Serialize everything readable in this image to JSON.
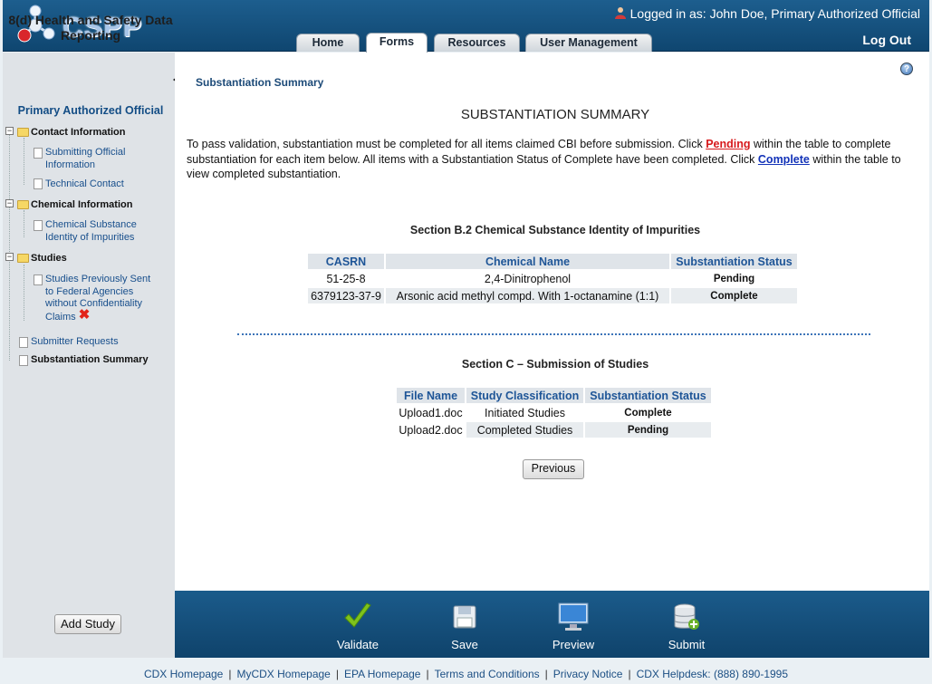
{
  "header": {
    "logo_text": "CSPP",
    "logged_in_prefix": "Logged in as:",
    "logged_in_user": "John Doe, Primary Authorized Official",
    "logout_label": "Log Out",
    "tabs": [
      {
        "label": "Home",
        "active": false
      },
      {
        "label": "Forms",
        "active": true
      },
      {
        "label": "Resources",
        "active": false
      },
      {
        "label": "User Management",
        "active": false
      }
    ]
  },
  "sidebar": {
    "title": "8(d) Health and Safety Data Reporting",
    "role": "Primary Authorized Official",
    "tree": {
      "contact": {
        "label": "Contact Information",
        "children": [
          "Submitting Official Information",
          "Technical Contact"
        ]
      },
      "chemical": {
        "label": "Chemical Information",
        "children": [
          "Chemical Substance Identity of Impurities"
        ]
      },
      "studies": {
        "label": "Studies",
        "children": [
          "Studies Previously Sent to Federal Agencies without Confidentiality Claims"
        ]
      },
      "submitter_requests": "Submitter Requests",
      "substantiation_summary": "Substantiation Summary"
    }
  },
  "main": {
    "breadcrumb": "Substantiation Summary",
    "heading": "SUBSTANTIATION SUMMARY",
    "intro": {
      "part1": "To pass validation, substantiation must be completed for all items claimed CBI before submission. Click ",
      "pending_link": "Pending",
      "part2": " within the table to complete substantiation for each item below. All items with a Substantiation Status of Complete have been completed. Click ",
      "complete_link": "Complete",
      "part3": " within the table to view completed substantiation."
    },
    "section_b2": {
      "title": "Section B.2 Chemical Substance Identity of Impurities",
      "columns": [
        "CASRN",
        "Chemical Name",
        "Substantiation Status"
      ],
      "rows": [
        {
          "casrn": "51-25-8",
          "name": "2,4-Dinitrophenol",
          "status": "Pending"
        },
        {
          "casrn": "6379123-37-9",
          "name": "Arsonic acid methyl compd. With 1-octanamine (1:1)",
          "status": "Complete"
        }
      ]
    },
    "section_c": {
      "title": "Section C – Submission of Studies",
      "columns": [
        "File Name",
        "Study Classification",
        "Substantiation Status"
      ],
      "rows": [
        {
          "file": "Upload1.doc",
          "classification": "Initiated Studies",
          "status": "Complete"
        },
        {
          "file": "Upload2.doc",
          "classification": "Completed Studies",
          "status": "Pending"
        }
      ]
    },
    "previous_label": "Previous"
  },
  "footer": {
    "add_study_label": "Add Study",
    "actions": [
      {
        "label": "Validate",
        "icon": "checkmark-icon"
      },
      {
        "label": "Save",
        "icon": "floppy-disk-icon"
      },
      {
        "label": "Preview",
        "icon": "monitor-icon"
      },
      {
        "label": "Submit",
        "icon": "database-add-icon"
      }
    ],
    "links": [
      "CDX Homepage",
      "MyCDX Homepage",
      "EPA Homepage",
      "Terms and Conditions",
      "Privacy Notice",
      "CDX Helpdesk: (888) 890-1995"
    ]
  },
  "colors": {
    "header_blue": "#1d5e8e",
    "pending_red": "#d41b1b",
    "complete_blue": "#1c5d95",
    "sidebar_gray": "#dfe3e7"
  }
}
